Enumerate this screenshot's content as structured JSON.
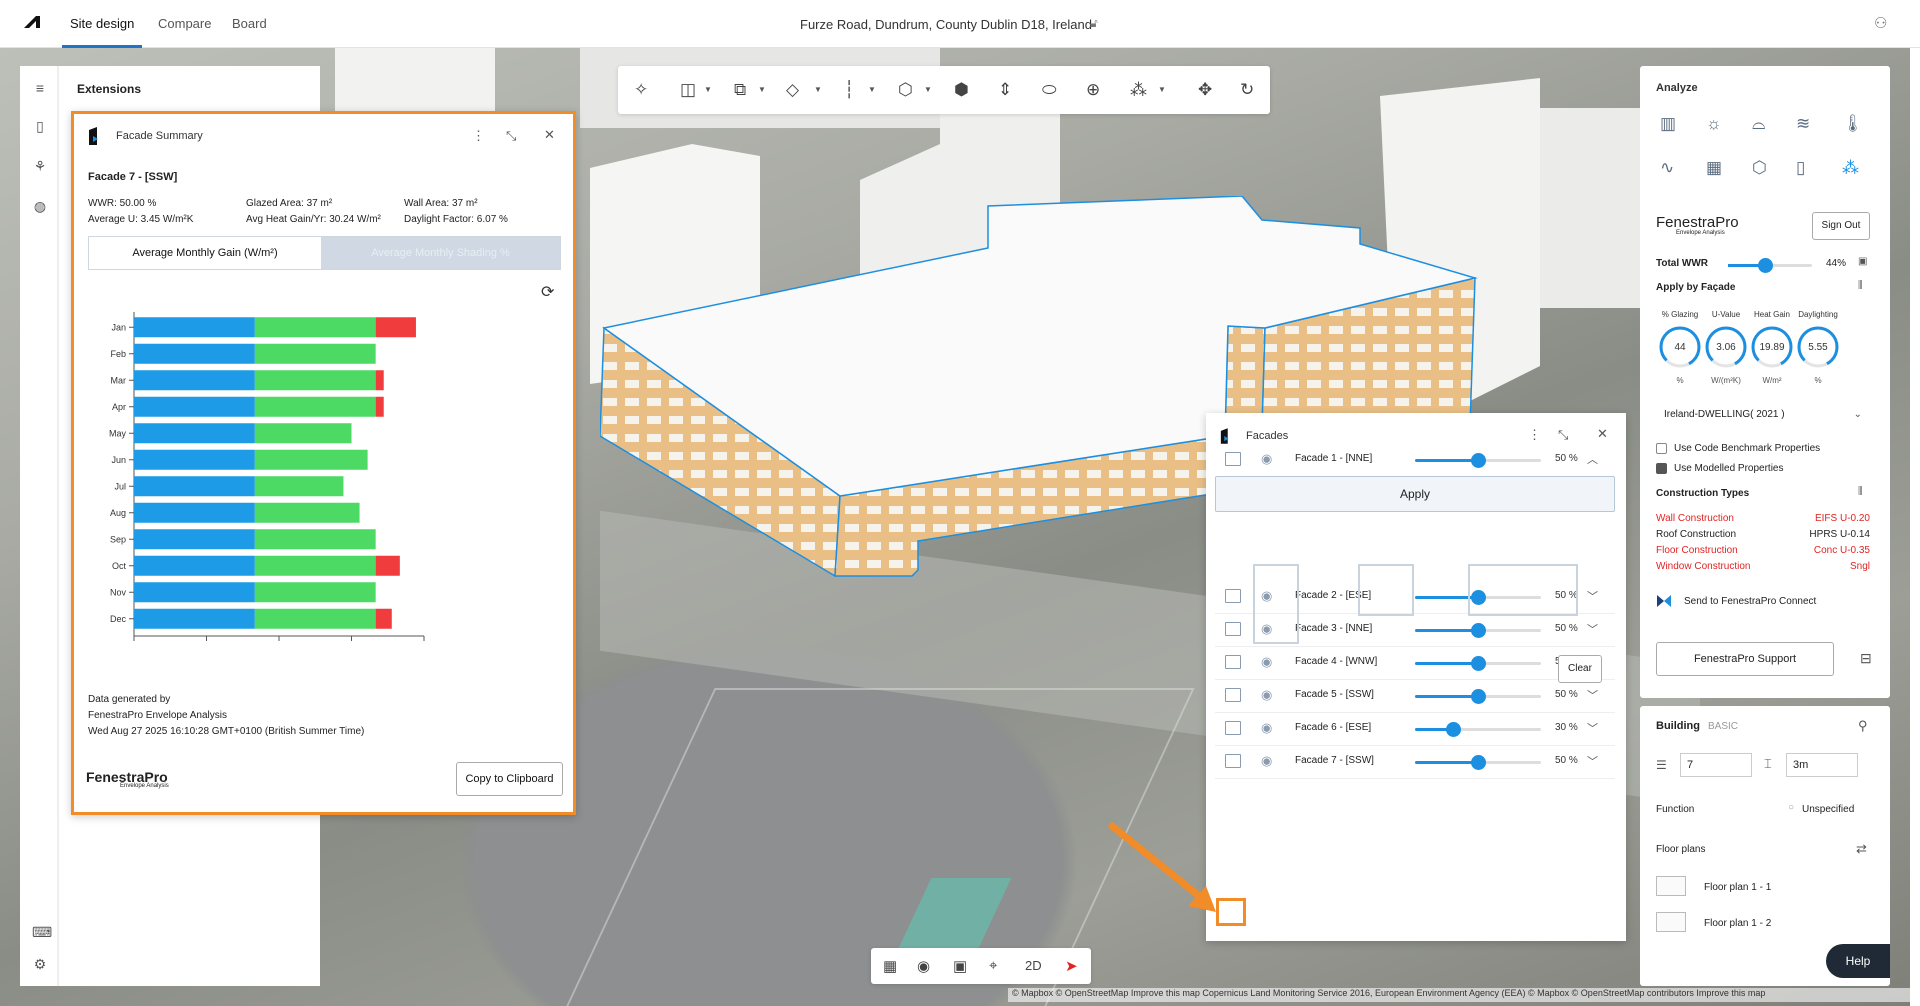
{
  "topbar": {
    "tabs": [
      {
        "label": "Site design"
      },
      {
        "label": "Compare"
      },
      {
        "label": "Board"
      }
    ],
    "address": "Furze Road, Dundrum, County Dublin D18, Ireland"
  },
  "extensions": {
    "title": "Extensions"
  },
  "facade_summary": {
    "title": "Facade Summary",
    "facade": "Facade 7 - [SSW]",
    "wwr": "WWR: 50.00 %",
    "avg_u": "Average U: 3.45 W/m²K",
    "glazed_area": "Glazed Area: 37 m²",
    "heat_gain": "Avg Heat Gain/Yr: 30.24 W/m²",
    "wall_area": "Wall Area: 37 m²",
    "daylight": "Daylight Factor: 6.07 %",
    "tab_active": "Average Monthly Gain (W/m²)",
    "tab_inactive": "Average Monthly Shading %",
    "generated_line1": "Data generated by",
    "generated_line2": "FenestraPro Envelope Analysis",
    "generated_line3": "Wed Aug 27 2025 16:10:28 GMT+0100 (British Summer Time)",
    "brand": "FenestraPro",
    "brand_sub": "Envelope Analysis",
    "copy_button": "Copy to Clipboard"
  },
  "chart_data": {
    "type": "bar",
    "orientation": "horizontal",
    "stacked": true,
    "categories": [
      "Jan",
      "Feb",
      "Mar",
      "Apr",
      "May",
      "Jun",
      "Jul",
      "Aug",
      "Sep",
      "Oct",
      "Nov",
      "Dec"
    ],
    "series": [
      {
        "color": "#1e9be6",
        "values": [
          15,
          15,
          15,
          15,
          15,
          15,
          15,
          15,
          15,
          15,
          15,
          15
        ]
      },
      {
        "color": "#4cd964",
        "values": [
          15,
          15,
          15,
          15,
          12,
          14,
          11,
          13,
          15,
          15,
          15,
          15
        ]
      },
      {
        "color": "#f03c3c",
        "values": [
          5,
          0,
          1,
          1,
          0,
          0,
          0,
          0,
          0,
          3,
          0,
          2
        ]
      }
    ],
    "xticks": [
      0,
      9,
      18,
      27,
      36
    ],
    "xlim": [
      0,
      36
    ],
    "xlabel": "",
    "ylabel": ""
  },
  "facades_panel": {
    "title": "Facades",
    "apply": "Apply",
    "clear": "Clear",
    "rows": [
      {
        "label": "Facade 1 - [NNE]",
        "pct": "50 %",
        "value": 0.5,
        "chev": "︿"
      },
      {
        "label": "Facade 2 - [ESE]",
        "pct": "50 %",
        "value": 0.5,
        "chev": "﹀"
      },
      {
        "label": "Facade 3 - [NNE]",
        "pct": "50 %",
        "value": 0.5,
        "chev": "﹀"
      },
      {
        "label": "Facade 4 - [WNW]",
        "pct": "50 %",
        "value": 0.5,
        "chev": "﹀"
      },
      {
        "label": "Facade 5 - [SSW]",
        "pct": "50 %",
        "value": 0.5,
        "chev": "﹀"
      },
      {
        "label": "Facade 6 - [ESE]",
        "pct": "30 %",
        "value": 0.3,
        "chev": "﹀"
      },
      {
        "label": "Facade 7 - [SSW]",
        "pct": "50 %",
        "value": 0.5,
        "chev": "﹀"
      }
    ]
  },
  "analyze": {
    "title": "Analyze",
    "brand": "FenestraPro",
    "brand_sub": "Envelope Analysis",
    "sign_out": "Sign Out",
    "total_wwr_label": "Total WWR",
    "total_wwr_value": "44%",
    "total_wwr_fraction": 0.44,
    "apply_by_facade": "Apply by Façade",
    "gauges": [
      {
        "label": "% Glazing",
        "value": "44",
        "unit": "%"
      },
      {
        "label": "U-Value",
        "value": "3.06",
        "unit": "W/(m²K)"
      },
      {
        "label": "Heat Gain",
        "value": "19.89",
        "unit": "W/m²"
      },
      {
        "label": "Daylighting",
        "value": "5.55",
        "unit": "%"
      }
    ],
    "benchmark_select": "Ireland-DWELLING( 2021 )",
    "use_code_benchmark": "Use Code Benchmark Properties",
    "use_modelled": "Use Modelled Properties",
    "construction_types": "Construction Types",
    "constructions": [
      {
        "name": "Wall Construction",
        "value": "EIFS U-0.20",
        "red": true
      },
      {
        "name": "Roof Construction",
        "value": "HPRS U-0.14",
        "red": false
      },
      {
        "name": "Floor Construction",
        "value": "Conc U-0.35",
        "red": true
      },
      {
        "name": "Window Construction",
        "value": "Sngl",
        "red": true
      }
    ],
    "send_connect": "Send to FenestraPro Connect",
    "support": "FenestraPro Support"
  },
  "building": {
    "title": "Building",
    "badge": "BASIC",
    "floors": "7",
    "height": "3m",
    "function_label": "Function",
    "function_value": "Unspecified",
    "floor_plans_label": "Floor plans",
    "floor_plans": [
      "Floor plan 1 - 1",
      "Floor plan 1 - 2"
    ]
  },
  "help": "Help",
  "view_mode": "2D",
  "attribution": "© Mapbox © OpenStreetMap Improve this map Copernicus Land Monitoring Service 2016, European Environment Agency (EEA) © Mapbox © OpenStreetMap contributors Improve this map"
}
